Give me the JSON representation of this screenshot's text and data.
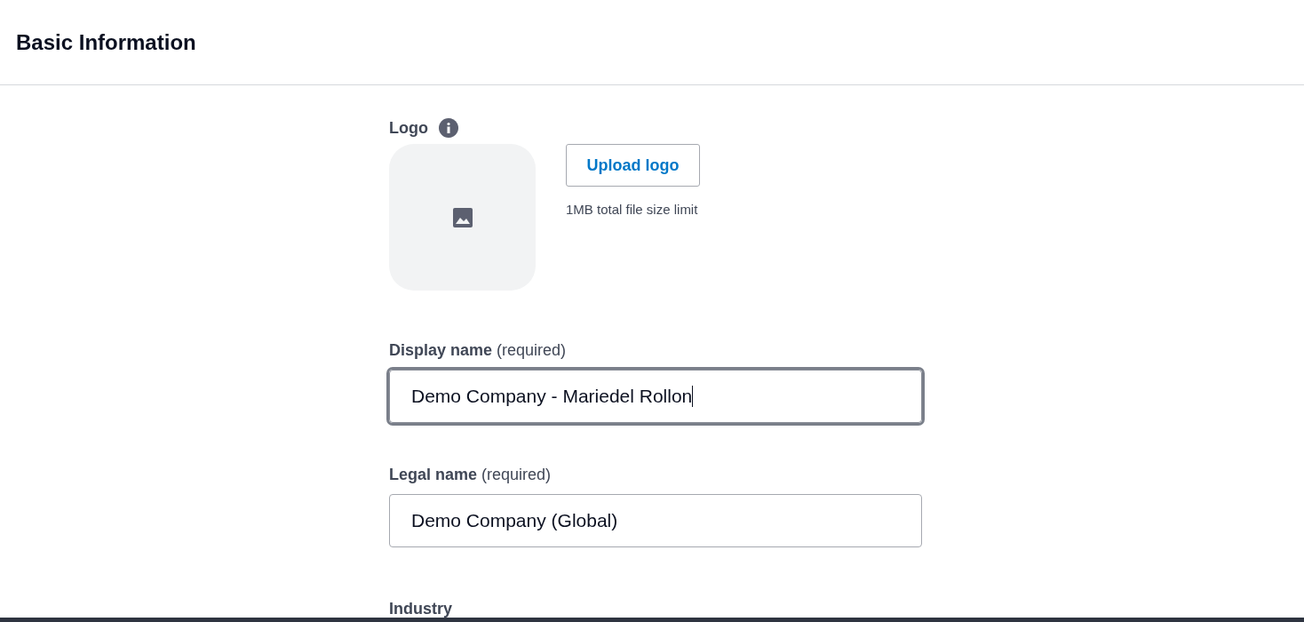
{
  "header": {
    "title": "Basic Information"
  },
  "logo": {
    "label": "Logo",
    "button": "Upload logo",
    "hint": "1MB total file size limit"
  },
  "fields": [
    {
      "label": "Display name",
      "note": "(required)",
      "value": "Demo Company - Mariedel Rollon",
      "focused": true
    },
    {
      "label": "Legal name",
      "note": "(required)",
      "value": "Demo Company (Global)",
      "focused": false
    }
  ],
  "next_section": {
    "label": "Industry"
  }
}
